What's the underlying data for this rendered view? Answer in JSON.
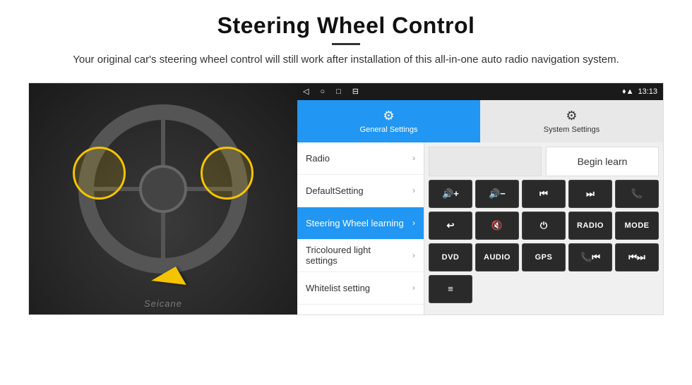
{
  "page": {
    "title": "Steering Wheel Control",
    "subtitle": "Your original car's steering wheel control will still work after installation of this all-in-one auto radio navigation system."
  },
  "statusBar": {
    "time": "13:13",
    "navIcons": [
      "◁",
      "○",
      "□",
      "⊟"
    ]
  },
  "tabs": [
    {
      "label": "General Settings",
      "icon": "⚙",
      "active": true
    },
    {
      "label": "System Settings",
      "icon": "🔧",
      "active": false
    }
  ],
  "menuItems": [
    {
      "label": "Radio",
      "active": false
    },
    {
      "label": "DefaultSetting",
      "active": false
    },
    {
      "label": "Steering Wheel learning",
      "active": true
    },
    {
      "label": "Tricoloured light settings",
      "active": false
    },
    {
      "label": "Whitelist setting",
      "active": false
    }
  ],
  "controls": {
    "beginLearn": "Begin learn",
    "row1": [
      "🔊+",
      "🔊−",
      "⏮",
      "⏭",
      "📞"
    ],
    "row2": [
      "↩",
      "🔇",
      "⏻",
      "RADIO",
      "MODE"
    ],
    "row3": [
      "DVD",
      "AUDIO",
      "GPS",
      "📞⏮",
      "⏮⏭"
    ],
    "row4": [
      "≡"
    ]
  }
}
